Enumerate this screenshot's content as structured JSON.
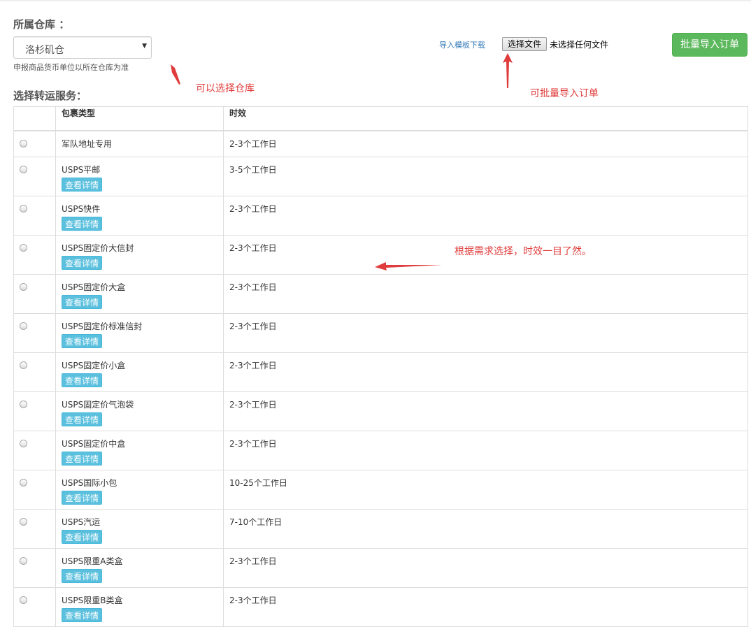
{
  "warehouse": {
    "label": "所属仓库 ：",
    "selected": "洛杉矶仓",
    "help": "申报商品货币单位以所在仓库为准"
  },
  "import": {
    "template_link": "导入模板下载",
    "file_button": "选择文件",
    "file_status": "未选择任何文件",
    "batch_button": "批量导入订单"
  },
  "service": {
    "label": "选择转运服务：",
    "columns": [
      "",
      "包裹类型",
      "时效"
    ],
    "detail_label": "查看详情",
    "rows": [
      {
        "type": "军队地址专用",
        "time": "2-3个工作日",
        "has_detail": false
      },
      {
        "type": "USPS平邮",
        "time": "3-5个工作日",
        "has_detail": true
      },
      {
        "type": "USPS快件",
        "time": "2-3个工作日",
        "has_detail": true
      },
      {
        "type": "USPS固定价大信封",
        "time": "2-3个工作日",
        "has_detail": true
      },
      {
        "type": "USPS固定价大盒",
        "time": "2-3个工作日",
        "has_detail": true
      },
      {
        "type": "USPS固定价标准信封",
        "time": "2-3个工作日",
        "has_detail": true
      },
      {
        "type": "USPS固定价小盒",
        "time": "2-3个工作日",
        "has_detail": true
      },
      {
        "type": "USPS固定价气泡袋",
        "time": "2-3个工作日",
        "has_detail": true
      },
      {
        "type": "USPS固定价中盒",
        "time": "2-3个工作日",
        "has_detail": true
      },
      {
        "type": "USPS国际小包",
        "time": "10-25个工作日",
        "has_detail": true
      },
      {
        "type": "USPS汽运",
        "time": "7-10个工作日",
        "has_detail": true
      },
      {
        "type": "USPS限重A类盒",
        "time": "2-3个工作日",
        "has_detail": true
      },
      {
        "type": "USPS限重B类盒",
        "time": "2-3个工作日",
        "has_detail": true
      }
    ]
  },
  "annotations": {
    "warehouse_note": "可以选择仓库",
    "import_note": "可批量导入订单",
    "service_note": "根据需求选择，时效一目了然。"
  },
  "colors": {
    "annotation": "#e03c3c",
    "success": "#5cb85c",
    "info": "#5bc0de",
    "link": "#337ab7"
  }
}
